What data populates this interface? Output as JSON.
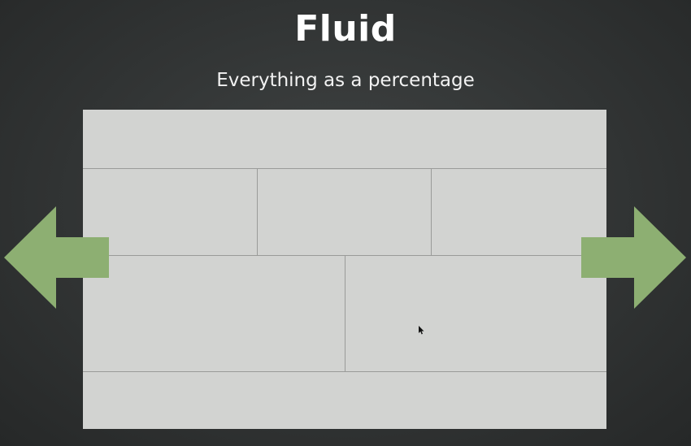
{
  "slide": {
    "title": "Fluid",
    "subtitle": "Everything as a percentage"
  },
  "colors": {
    "background": "#343737",
    "box_fill": "#d2d3d1",
    "grid_line": "#9a9b99",
    "arrow": "#8daf72",
    "title_text": "#ffffff"
  },
  "icons": {
    "left": "arrow-left-icon",
    "right": "arrow-right-icon",
    "cursor": "mouse-pointer-icon"
  }
}
